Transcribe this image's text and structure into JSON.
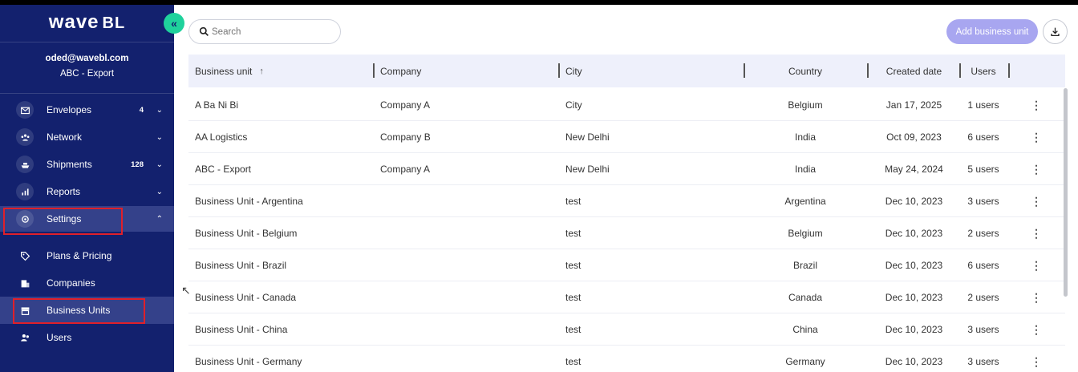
{
  "sidebar": {
    "logo_main": "wave",
    "logo_suffix": "BL",
    "user_email": "oded@wavebl.com",
    "user_org": "ABC - Export",
    "nav": [
      {
        "label": "Envelopes",
        "count": "4",
        "icon": "envelope-icon"
      },
      {
        "label": "Network",
        "count": "",
        "icon": "network-icon"
      },
      {
        "label": "Shipments",
        "count": "128",
        "icon": "ship-icon"
      },
      {
        "label": "Reports",
        "count": "",
        "icon": "chart-icon"
      },
      {
        "label": "Settings",
        "count": "",
        "icon": "gear-icon"
      }
    ],
    "sub": [
      {
        "label": "Plans & Pricing",
        "icon": "tag-icon"
      },
      {
        "label": "Companies",
        "icon": "building-icon"
      },
      {
        "label": "Business Units",
        "icon": "store-icon"
      },
      {
        "label": "Users",
        "icon": "users-icon"
      }
    ]
  },
  "toolbar": {
    "search_placeholder": "Search",
    "add_label": "Add business unit"
  },
  "table": {
    "headers": {
      "business_unit": "Business unit",
      "company": "Company",
      "city": "City",
      "country": "Country",
      "created": "Created date",
      "users": "Users"
    },
    "rows": [
      {
        "bu": "A Ba Ni Bi",
        "company": "Company A",
        "city": "City",
        "country": "Belgium",
        "created": "Jan 17, 2025",
        "users": "1 users"
      },
      {
        "bu": "AA Logistics",
        "company": "Company B",
        "city": "New Delhi",
        "country": "India",
        "created": "Oct 09, 2023",
        "users": "6 users"
      },
      {
        "bu": "ABC - Export",
        "company": "Company A",
        "city": "New Delhi",
        "country": "India",
        "created": "May 24, 2024",
        "users": "5 users"
      },
      {
        "bu": "Business Unit - Argentina",
        "company": "",
        "city": "test",
        "country": "Argentina",
        "created": "Dec 10, 2023",
        "users": "3 users"
      },
      {
        "bu": "Business Unit - Belgium",
        "company": "",
        "city": "test",
        "country": "Belgium",
        "created": "Dec 10, 2023",
        "users": "2 users"
      },
      {
        "bu": "Business Unit - Brazil",
        "company": "",
        "city": "test",
        "country": "Brazil",
        "created": "Dec 10, 2023",
        "users": "6 users"
      },
      {
        "bu": "Business Unit - Canada",
        "company": "",
        "city": "test",
        "country": "Canada",
        "created": "Dec 10, 2023",
        "users": "2 users"
      },
      {
        "bu": "Business Unit - China",
        "company": "",
        "city": "test",
        "country": "China",
        "created": "Dec 10, 2023",
        "users": "3 users"
      },
      {
        "bu": "Business Unit - Germany",
        "company": "",
        "city": "test",
        "country": "Germany",
        "created": "Dec 10, 2023",
        "users": "3 users"
      }
    ]
  },
  "colors": {
    "sidebar_bg": "#13216e",
    "accent_green": "#1fd29c",
    "add_button": "#a8a6f0",
    "header_bg": "#eef0fb",
    "highlight": "#e0202a"
  }
}
